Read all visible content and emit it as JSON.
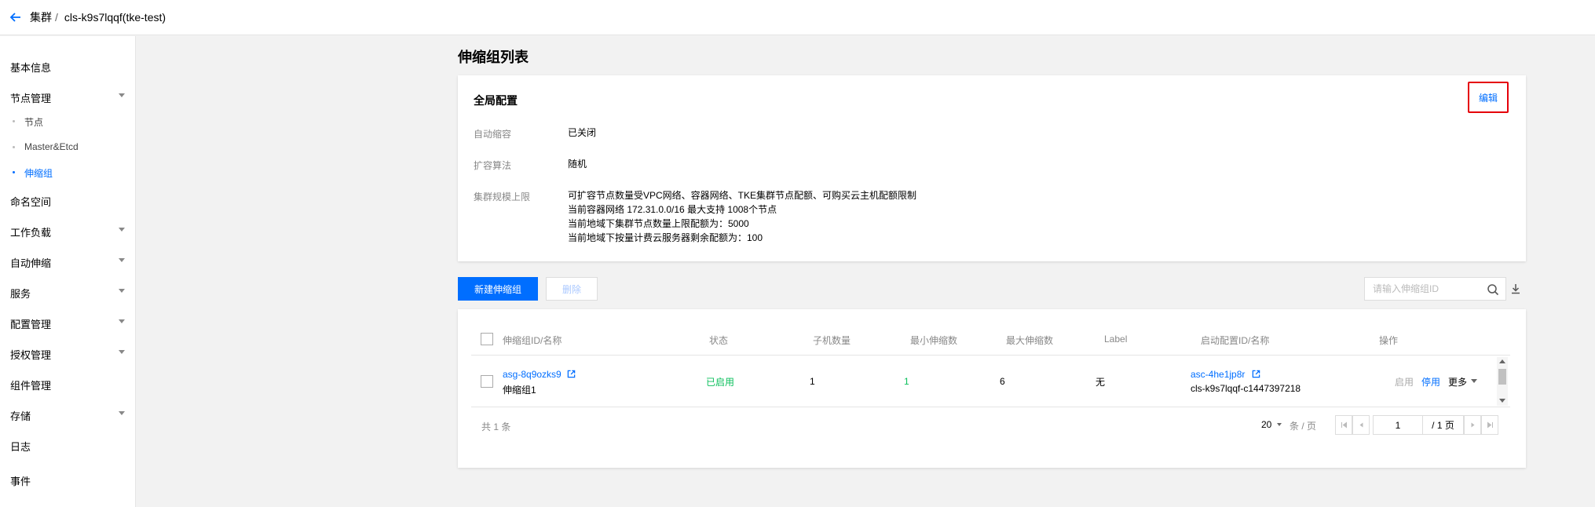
{
  "header": {
    "breadcrumb_root": "集群",
    "breadcrumb_sep": "/",
    "cluster_name": "cls-k9s7lqqf(tke-test)"
  },
  "sidebar": {
    "items": [
      {
        "label": "基本信息"
      },
      {
        "label": "节点管理"
      },
      {
        "label": "命名空间"
      },
      {
        "label": "工作负载"
      },
      {
        "label": "自动伸缩"
      },
      {
        "label": "服务"
      },
      {
        "label": "配置管理"
      },
      {
        "label": "授权管理"
      },
      {
        "label": "组件管理"
      },
      {
        "label": "存储"
      },
      {
        "label": "日志"
      },
      {
        "label": "事件"
      }
    ],
    "subitems": [
      {
        "label": "节点"
      },
      {
        "label": "Master&Etcd"
      },
      {
        "label": "伸缩组"
      }
    ]
  },
  "page": {
    "title": "伸缩组列表"
  },
  "global_config": {
    "title": "全局配置",
    "edit_label": "编辑",
    "auto_scale_label": "自动缩容",
    "auto_scale_value": "已关闭",
    "algorithm_label": "扩容算法",
    "algorithm_value": "随机",
    "limit_label": "集群规模上限",
    "limit_lines": [
      "可扩容节点数量受VPC网络、容器网络、TKE集群节点配额、可购买云主机配额限制",
      "当前容器网络 172.31.0.0/16 最大支持 1008个节点",
      "当前地域下集群节点数量上限配额为：5000",
      "当前地域下按量计费云服务器剩余配额为：100"
    ]
  },
  "toolbar": {
    "create_label": "新建伸缩组",
    "delete_label": "删除",
    "search_placeholder": "请输入伸缩组ID"
  },
  "table": {
    "columns": [
      "伸缩组ID/名称",
      "状态",
      "子机数量",
      "最小伸缩数",
      "最大伸缩数",
      "Label",
      "启动配置ID/名称",
      "操作"
    ],
    "rows": [
      {
        "id": "asg-8q9ozks9",
        "name": "伸缩组1",
        "status": "已启用",
        "count": "1",
        "min": "1",
        "max": "6",
        "label": "无",
        "config_id": "asc-4he1jp8r",
        "config_name": "cls-k9s7lqqf-c1447397218",
        "action_enable": "启用",
        "action_disable": "停用",
        "action_more": "更多"
      }
    ]
  },
  "pagination": {
    "total": "共 1 条",
    "page_size": "20",
    "page_size_unit": "条 / 页",
    "current_page": "1",
    "total_pages": "/ 1 页"
  },
  "colors": {
    "accent": "#006eff",
    "enabled_green": "#0abf5b",
    "highlight_red": "#e5000a"
  }
}
